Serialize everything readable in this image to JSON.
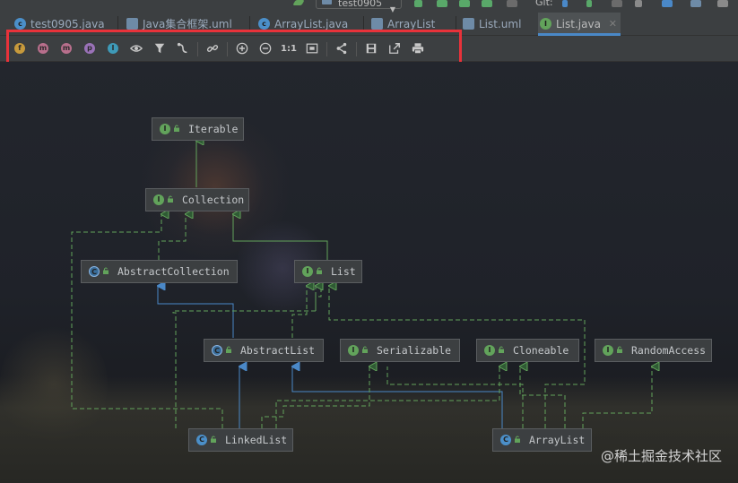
{
  "topbar": {
    "run_config": "test0905",
    "git_label": "Git:"
  },
  "tabs": [
    {
      "label": "test0905.java",
      "icon": "class-icon",
      "color": "#4b8fc9"
    },
    {
      "label": "Java集合框架.uml",
      "icon": "uml-diagram-icon",
      "color": "#6e8ba7"
    },
    {
      "label": "ArrayList.java",
      "icon": "class-icon",
      "color": "#4b8fc9"
    },
    {
      "label": "ArrayList",
      "icon": "uml-diagram-icon",
      "color": "#6e8ba7"
    },
    {
      "label": "List.uml",
      "icon": "uml-file-icon",
      "color": "#6e8ba7"
    },
    {
      "label": "List.java",
      "icon": "interface-icon",
      "color": "#62a35b"
    }
  ],
  "active_tab": "List.java",
  "toolbar": {
    "fields_letter": "f",
    "constructors_letter": "m",
    "methods_letter": "m",
    "properties_letter": "p",
    "inner_letter": "I",
    "actual_size_label": "1:1"
  },
  "diagram": {
    "nodes": {
      "iterable": {
        "label": "Iterable",
        "kind": "interface",
        "icon_letter": "I"
      },
      "collection": {
        "label": "Collection",
        "kind": "interface",
        "icon_letter": "I"
      },
      "abstract_collection": {
        "label": "AbstractCollection",
        "kind": "abstract",
        "icon_letter": "C"
      },
      "list": {
        "label": "List",
        "kind": "interface",
        "icon_letter": "I"
      },
      "abstract_list": {
        "label": "AbstractList",
        "kind": "abstract",
        "icon_letter": "C"
      },
      "serializable": {
        "label": "Serializable",
        "kind": "interface",
        "icon_letter": "I"
      },
      "cloneable": {
        "label": "Cloneable",
        "kind": "interface",
        "icon_letter": "I"
      },
      "random_access": {
        "label": "RandomAccess",
        "kind": "interface",
        "icon_letter": "I"
      },
      "linked_list": {
        "label": "LinkedList",
        "kind": "class",
        "icon_letter": "C"
      },
      "array_list": {
        "label": "ArrayList",
        "kind": "class",
        "icon_letter": "C"
      }
    },
    "colors": {
      "implements": "#62a35b",
      "extends": "#4a88c7",
      "highlight": "#e8323a"
    }
  },
  "watermark": "@稀土掘金技术社区"
}
